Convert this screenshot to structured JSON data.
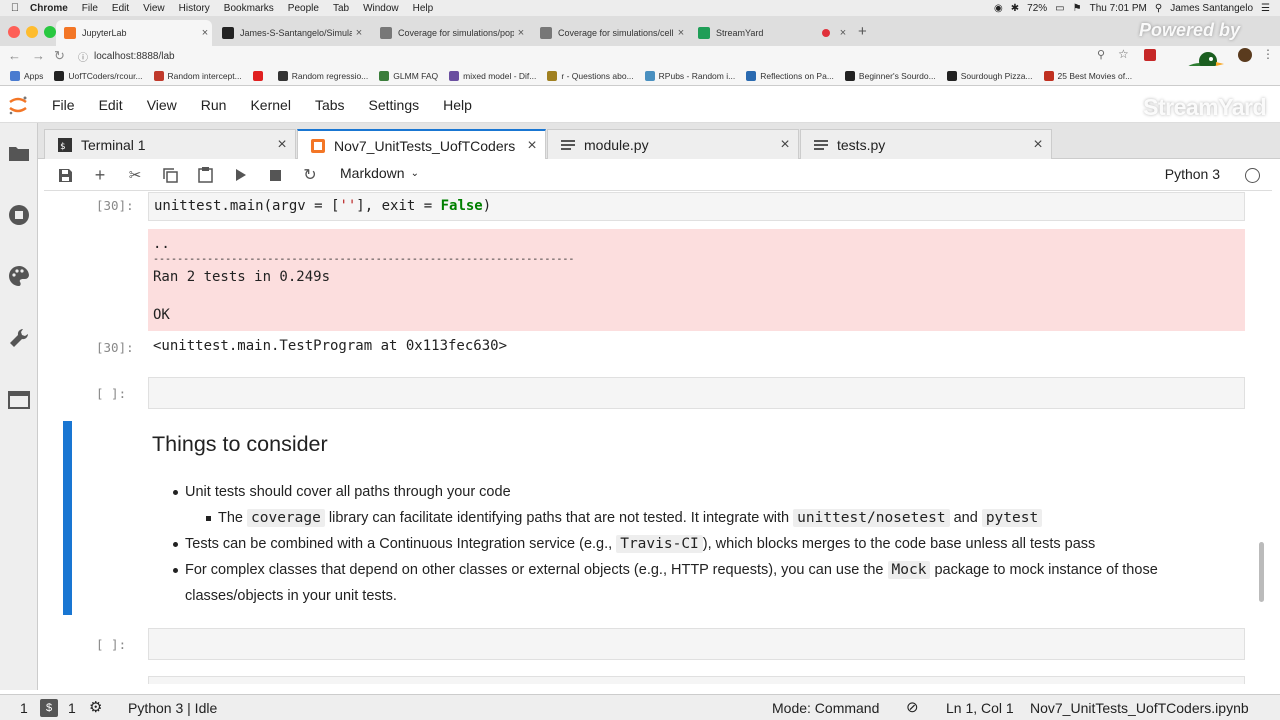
{
  "os_menubar": {
    "app": "Chrome",
    "items": [
      "File",
      "Edit",
      "View",
      "History",
      "Bookmarks",
      "People",
      "Tab",
      "Window",
      "Help"
    ],
    "battery": "72%",
    "clock": "Thu 7:01 PM",
    "user": "James Santangelo"
  },
  "browser": {
    "tabs": [
      {
        "title": "JupyterLab",
        "color": "#f37626"
      },
      {
        "title": "James-S-Santangelo/Simulati",
        "color": "#222222"
      },
      {
        "title": "Coverage for simulations/popu",
        "color": "#555555"
      },
      {
        "title": "Coverage for simulations/cell.",
        "color": "#555555"
      },
      {
        "title": "StreamYard",
        "color": "#1f9e57"
      }
    ],
    "url": "localhost:8888/lab",
    "bookmarks": [
      {
        "label": "Apps",
        "color": "#4a7bd0"
      },
      {
        "label": "UofTCoders/rcour...",
        "color": "#222222"
      },
      {
        "label": "Random intercept...",
        "color": "#c0392b"
      },
      {
        "label": "",
        "color": "#e02020"
      },
      {
        "label": "Random regressio...",
        "color": "#333333"
      },
      {
        "label": "GLMM FAQ",
        "color": "#3a7d3a"
      },
      {
        "label": "mixed model - Dif...",
        "color": "#6a4fa0"
      },
      {
        "label": "r - Questions abo...",
        "color": "#a08020"
      },
      {
        "label": "RPubs - Random i...",
        "color": "#4a90c0"
      },
      {
        "label": "Reflections on Pa...",
        "color": "#2a6ab0"
      },
      {
        "label": "Beginner's Sourdo...",
        "color": "#222222"
      },
      {
        "label": "Sourdough Pizza...",
        "color": "#222222"
      },
      {
        "label": "25 Best Movies of...",
        "color": "#c03020"
      }
    ]
  },
  "overlay": {
    "powered_by": "Powered by",
    "brand": "StreamYard"
  },
  "jupyter": {
    "menu": [
      "File",
      "Edit",
      "View",
      "Run",
      "Kernel",
      "Tabs",
      "Settings",
      "Help"
    ],
    "doc_tabs": [
      {
        "label": "Terminal 1",
        "icon": "terminal-icon"
      },
      {
        "label": "Nov7_UnitTests_UofTCoders",
        "icon": "notebook-icon"
      },
      {
        "label": "module.py",
        "icon": "text-file-icon"
      },
      {
        "label": "tests.py",
        "icon": "text-file-icon"
      }
    ],
    "cell_type": "Markdown",
    "kernel": "Python 3",
    "accent": "#1976d2"
  },
  "cells": {
    "c1_prompt": "[30]:",
    "c1_code": {
      "fn": "unittest.main",
      "open": "(argv = [",
      "str": "''",
      "mid": "], exit = ",
      "kw": "False",
      "close": ")"
    },
    "c1_stderr": {
      "dots": "..",
      "rule": "----------------------------------------------------------------------",
      "ran": "Ran 2 tests in 0.249s",
      "ok": "OK"
    },
    "c1_out_prompt": "[30]:",
    "c1_out": "<unittest.main.TestProgram at 0x113fec630>",
    "c2_prompt": "[ ]:",
    "c4_prompt": "[ ]:"
  },
  "markdown": {
    "heading": "Things to consider",
    "b1": "Unit tests should cover all paths through your code",
    "b1a_pre": "The ",
    "b1a_code1": "coverage",
    "b1a_mid": " library can facilitate identifying paths that are not tested. It integrate with ",
    "b1a_code2": "unittest/nosetest",
    "b1a_and": " and ",
    "b1a_code3": "pytest",
    "b2_pre": "Tests can be combined with a Continuous Integration service (e.g., ",
    "b2_code": "Travis-CI",
    "b2_post": "), which blocks merges to the code base unless all tests pass",
    "b3_pre": "For complex classes that depend on other classes or external objects (e.g., HTTP requests), you can use the ",
    "b3_code": "Mock",
    "b3_post": " package to mock instance of those classes/objects in your unit tests."
  },
  "statusbar": {
    "terminals": "1",
    "kernels": "1",
    "kernel_state": "Python 3 | Idle",
    "mode": "Mode: Command",
    "position": "Ln 1, Col 1",
    "filename": "Nov7_UnitTests_UofTCoders.ipynb"
  }
}
